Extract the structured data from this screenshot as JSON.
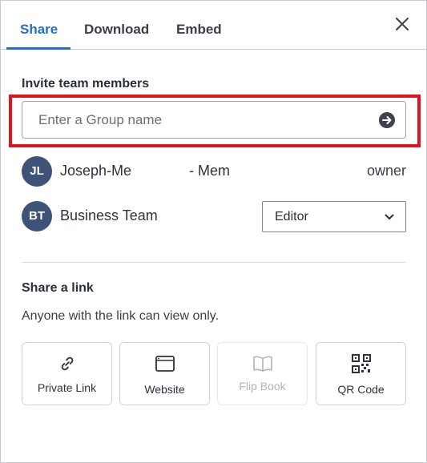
{
  "tabs": {
    "share": "Share",
    "download": "Download",
    "embed": "Embed",
    "active": "Share"
  },
  "invite": {
    "title": "Invite team members",
    "placeholder": "Enter a Group name",
    "value": ""
  },
  "members": [
    {
      "initials": "JL",
      "name_start": "Joseph-Me",
      "name_end": "- Mem",
      "role": "owner"
    },
    {
      "initials": "BT",
      "name": "Business Team",
      "role": "Editor"
    }
  ],
  "share_link": {
    "title": "Share a link",
    "description": "Anyone with the link can view only.",
    "options": [
      {
        "label": "Private Link",
        "icon": "link-icon",
        "enabled": true
      },
      {
        "label": "Website",
        "icon": "browser-window-icon",
        "enabled": true
      },
      {
        "label": "Flip Book",
        "icon": "book-icon",
        "enabled": false
      },
      {
        "label": "QR Code",
        "icon": "qr-code-icon",
        "enabled": true
      }
    ]
  },
  "colors": {
    "accent": "#1f6fd1",
    "avatar": "#3f5378",
    "highlight": "#e0141c"
  }
}
